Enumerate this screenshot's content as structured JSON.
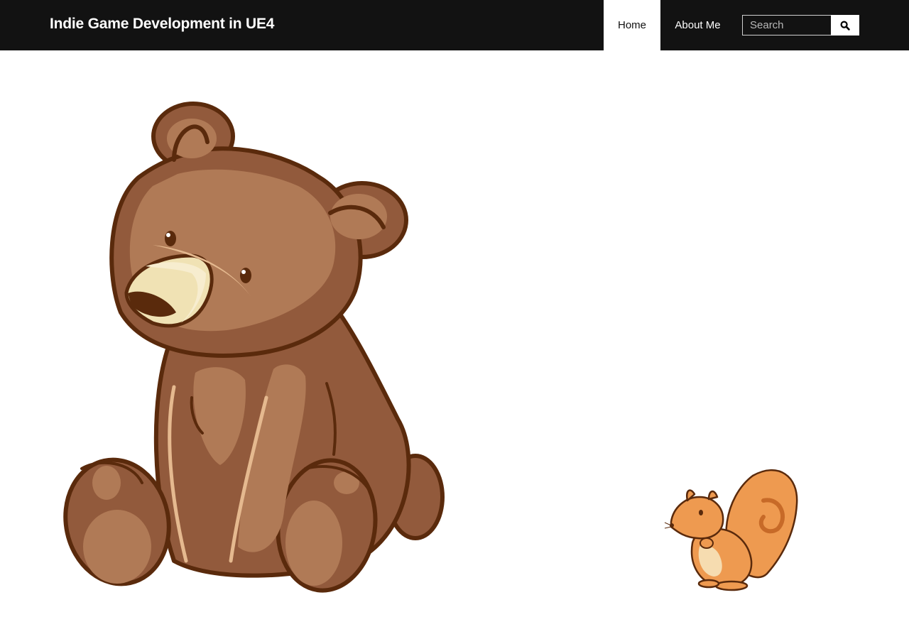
{
  "header": {
    "site_title": "Indie Game Development in UE4",
    "nav": [
      {
        "label": "Home",
        "active": true
      },
      {
        "label": "About Me",
        "active": false
      }
    ],
    "search": {
      "placeholder": "Search",
      "value": "",
      "button_icon": "search-icon"
    }
  },
  "main": {
    "illustrations": [
      {
        "subject": "bear-illustration",
        "alt": ""
      },
      {
        "subject": "squirrel-illustration",
        "alt": ""
      }
    ]
  },
  "colors": {
    "header_bg": "#121212",
    "active_nav_bg": "#ffffff",
    "bear_outline": "#5a2a0c",
    "bear_fur": "#b07a56",
    "bear_shadow": "#925a3c",
    "squirrel_fur": "#ee9a50"
  }
}
